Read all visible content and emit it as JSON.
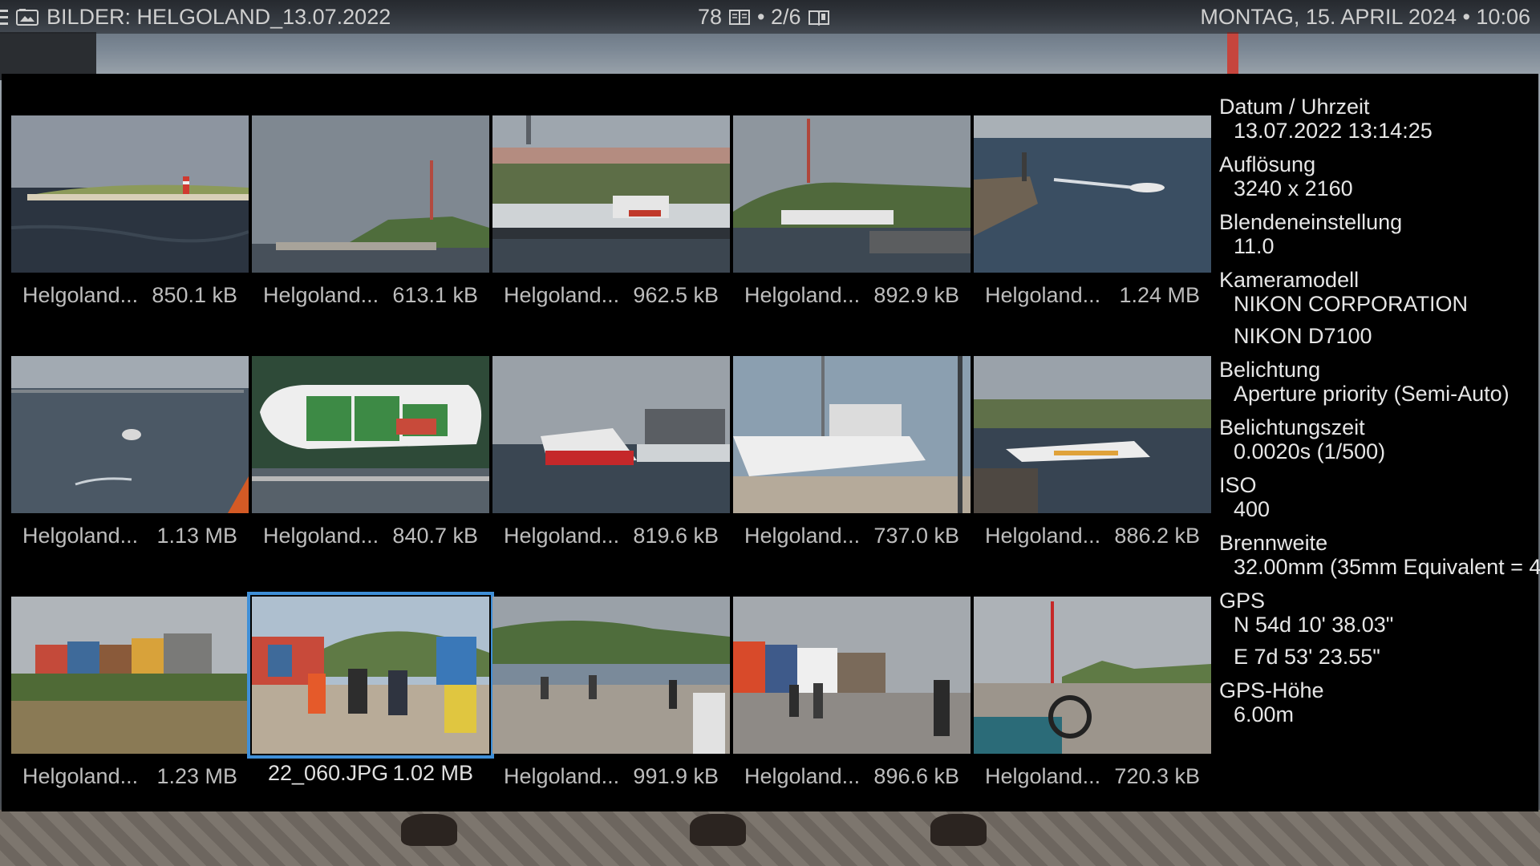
{
  "topbar": {
    "title": "BILDER: HELGOLAND_13.07.2022",
    "count": "78",
    "page": "• 2/6",
    "datetime": "MONTAG, 15. APRIL 2024 • 10:06"
  },
  "tiles": [
    {
      "name": "Helgoland...",
      "size": "850.1 kB",
      "scene": "sea-lighthouse"
    },
    {
      "name": "Helgoland...",
      "size": "613.1 kB",
      "scene": "island-tower"
    },
    {
      "name": "Helgoland...",
      "size": "962.5 kB",
      "scene": "harbor-town"
    },
    {
      "name": "Helgoland...",
      "size": "892.9 kB",
      "scene": "island-harbor"
    },
    {
      "name": "Helgoland...",
      "size": "1.24 MB",
      "scene": "pier-boat"
    },
    {
      "name": "Helgoland...",
      "size": "1.13 MB",
      "scene": "open-sea"
    },
    {
      "name": "Helgoland...",
      "size": "840.7 kB",
      "scene": "boat-top"
    },
    {
      "name": "Helgoland...",
      "size": "819.6 kB",
      "scene": "red-catamaran"
    },
    {
      "name": "Helgoland...",
      "size": "737.0 kB",
      "scene": "ship-quay"
    },
    {
      "name": "Helgoland...",
      "size": "886.2 kB",
      "scene": "marina"
    },
    {
      "name": "Helgoland...",
      "size": "1.23 MB",
      "scene": "colored-houses"
    },
    {
      "name": "22_060.JPG",
      "size": "1.02 MB",
      "scene": "promenade-people",
      "selected": true
    },
    {
      "name": "Helgoland...",
      "size": "991.9 kB",
      "scene": "crowd-square"
    },
    {
      "name": "Helgoland...",
      "size": "896.6 kB",
      "scene": "street-houses"
    },
    {
      "name": "Helgoland...",
      "size": "720.3 kB",
      "scene": "pram-promenade"
    }
  ],
  "info": {
    "datum_label": "Datum / Uhrzeit",
    "datum_value": "13.07.2022 13:14:25",
    "aufl_label": "Auflösung",
    "aufl_value": "3240 x 2160",
    "blende_label": "Blendeneinstellung",
    "blende_value": "11.0",
    "kamera_label": "Kameramodell",
    "kamera_value1": "NIKON CORPORATION",
    "kamera_value2": "NIKON D7100",
    "belichtung_label": "Belichtung",
    "belichtung_value": "Aperture priority (Semi-Auto)",
    "zeit_label": "Belichtungszeit",
    "zeit_value": "0.0020s (1/500)",
    "iso_label": "ISO",
    "iso_value": "400",
    "brenn_label": "Brennweite",
    "brenn_value": "32.00mm  (35mm Equivalent = 4",
    "gps_label": "GPS",
    "gps_value1": "N 54d 10' 38.03\"",
    "gps_value2": "E  7d 53' 23.55\"",
    "gpsh_label": "GPS-Höhe",
    "gpsh_value": "6.00m"
  },
  "colors": {
    "selection": "#3f8fd8",
    "panel_bg": "#000000",
    "text": "#bdbdbd"
  }
}
